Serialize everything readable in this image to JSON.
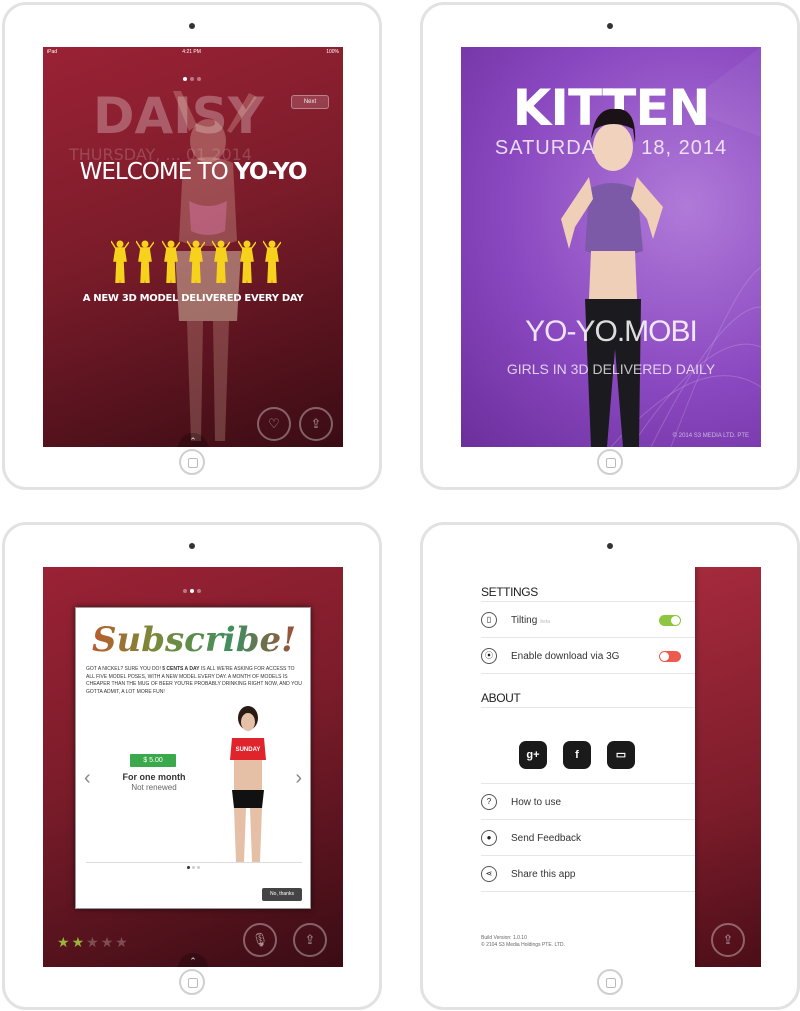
{
  "screen1": {
    "status_left": "iPad",
    "status_time": "4:21 PM",
    "status_battery": "100%",
    "ghost_name": "DAISY",
    "ghost_date": "THURSDAY, ... 01 2014",
    "next_label": "Next",
    "welcome_prefix": "WELCOME TO ",
    "welcome_brand": "YO-YO",
    "tagline": "A NEW 3D MODEL DELIVERED EVERY DAY",
    "silhouette_count": 7,
    "page_dots": 3,
    "active_dot": 1,
    "accent": "#f7d21c"
  },
  "screen2": {
    "title": "KITTEN",
    "date": "SATURDAY ... 18, 2014",
    "brand": "YO-YO.MOBI",
    "subtitle": "GIRLS IN 3D DELIVERED DAILY",
    "copyright": "© 2014 S3 MEDIA LTD. PTE"
  },
  "screen3": {
    "title": "Subscribe!",
    "body_prefix": "GOT A NICKEL? SURE YOU DO! ",
    "body_bold": "5 CENTS A DAY",
    "body_rest": " IS ALL WE'RE ASKING FOR ACCESS TO ALL FIVE MODEL POSES, WITH A NEW MODEL EVERY DAY. A MONTH OF MODELS IS CHEAPER THAN THE MUG OF BEER YOU'RE PROBABLY DRINKING RIGHT NOW, AND YOU GOTTA ADMIT, A LOT MORE FUN!",
    "price": "$ 5.00",
    "plan": "For one month",
    "plan_status": "Not renewed",
    "shirt_text": "SUNDAY",
    "no_thanks": "No, thanks",
    "rating": 2,
    "rating_max": 5
  },
  "screen4": {
    "settings_heading": "SETTINGS",
    "tilting_label": "Tilting",
    "tilting_note": "beta",
    "tilting_on": true,
    "download_label": "Enable download via 3G",
    "download_on": false,
    "about_heading": "ABOUT",
    "social_gplus": "g+",
    "social_facebook": "f",
    "social_other": "▭",
    "how_to_use": "How to use",
    "send_feedback": "Send Feedback",
    "share_app": "Share this app",
    "build_version": "Build Version: 1.0.10",
    "copyright": "© 2104 S3 Media Holdings PTE. LTD."
  }
}
